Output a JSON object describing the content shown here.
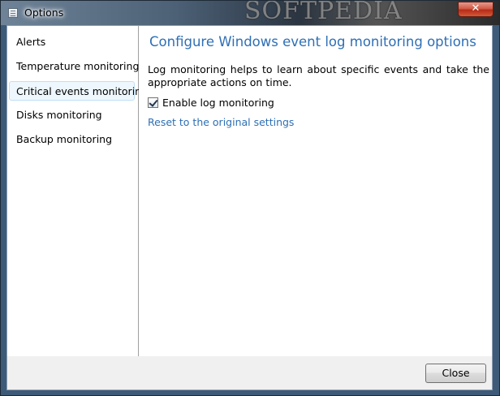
{
  "window": {
    "title": "Options",
    "watermark": "SOFTPEDIA",
    "close_glyph": "✕"
  },
  "sidebar": {
    "items": [
      {
        "label": "Alerts"
      },
      {
        "label": "Temperature monitoring"
      },
      {
        "label": "Critical events monitoring",
        "selected": true
      },
      {
        "label": "Disks monitoring"
      },
      {
        "label": "Backup monitoring"
      }
    ]
  },
  "main": {
    "heading": "Configure Windows event log monitoring options",
    "description": "Log monitoring helps to learn about specific events and take the appropriate actions on time.",
    "enable_checkbox": {
      "label": "Enable log monitoring",
      "checked": true
    },
    "reset_link": "Reset to the original settings"
  },
  "footer": {
    "close_label": "Close"
  },
  "colors": {
    "accent": "#2e6fb5",
    "selection_bg": "#eef7fd",
    "selection_border": "#bfe0f5"
  }
}
